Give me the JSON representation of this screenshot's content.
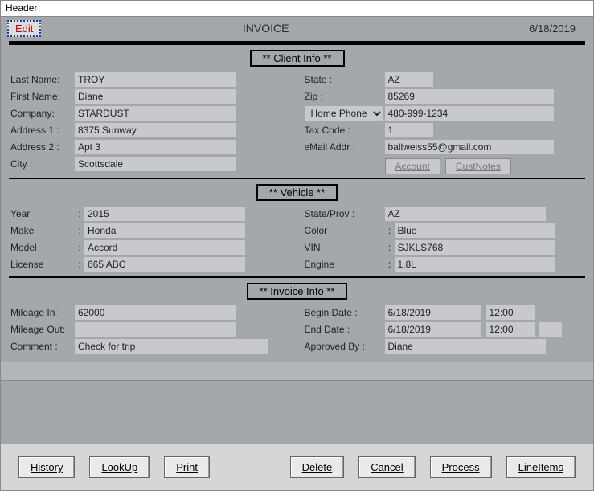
{
  "window": {
    "title": "Header"
  },
  "header": {
    "edit": "Edit",
    "title": "INVOICE",
    "date": "6/18/2019"
  },
  "sections": {
    "client": "**  Client Info  **",
    "vehicle": "**   Vehicle   **",
    "invoice": "**  Invoice Info  **"
  },
  "client": {
    "labels": {
      "last": "Last Name:",
      "first": "First Name:",
      "company": "Company:",
      "addr1": "Address 1 :",
      "addr2": "Address 2 :",
      "city": "City :",
      "state": "State :",
      "zip": "Zip :",
      "phoneSel": "Home Phone",
      "tax": "Tax Code :",
      "email": "eMail Addr :"
    },
    "values": {
      "last": "TROY",
      "first": "Diane",
      "company": "STARDUST",
      "addr1": "8375 Sunway",
      "addr2": "Apt 3",
      "city": "Scottsdale",
      "state": "AZ",
      "zip": "85269",
      "phone": "480-999-1234",
      "tax": "1",
      "email": "ballweiss55@gmail.com"
    },
    "buttons": {
      "account": "Account",
      "notes": "CustNotes"
    }
  },
  "vehicle": {
    "labels": {
      "year": "Year",
      "make": "Make",
      "model": "Model",
      "license": "License",
      "stateprov": "State/Prov :",
      "color": "Color",
      "vin": "VIN",
      "engine": "Engine"
    },
    "values": {
      "year": "2015",
      "make": "Honda",
      "model": "Accord",
      "license": "665 ABC",
      "stateprov": "AZ",
      "color": "Blue",
      "vin": "SJKLS768",
      "engine": "1.8L"
    }
  },
  "invoice": {
    "labels": {
      "milein": "Mileage In :",
      "mileout": "Mileage Out:",
      "comment": "Comment :",
      "begin": "Begin Date :",
      "end": "End Date :",
      "approved": "Approved By :"
    },
    "values": {
      "milein": "62000",
      "mileout": "",
      "comment": "Check for trip",
      "beginDate": "6/18/2019",
      "beginTime": "12:00",
      "endDate": "6/18/2019",
      "endTime": "12:00",
      "endExtra": "",
      "approved": "Diane"
    }
  },
  "footer": {
    "history": "History",
    "lookup": "LookUp",
    "print": "Print",
    "delete": "Delete",
    "cancel": "Cancel",
    "process": "Process",
    "lineitems": "LineItems"
  }
}
